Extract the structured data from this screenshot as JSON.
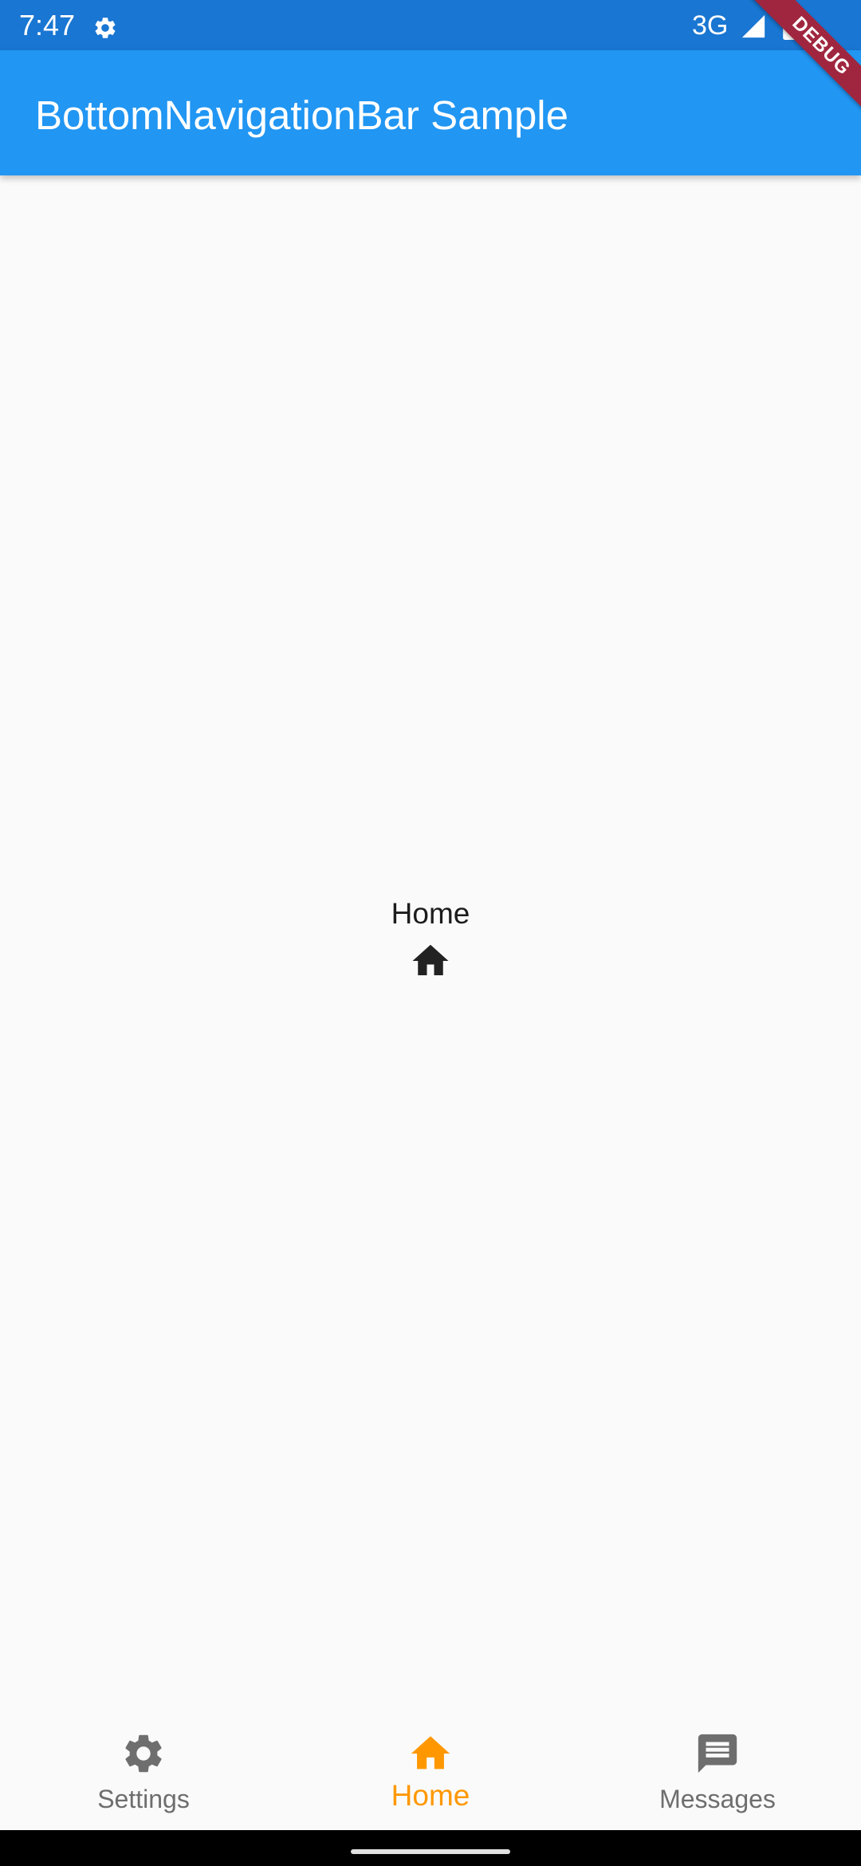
{
  "status_bar": {
    "time": "7:47",
    "network": "3G",
    "icons": [
      "settings-gear-icon",
      "signal-icon",
      "battery-icon"
    ]
  },
  "app_bar": {
    "title": "BottomNavigationBar Sample"
  },
  "debug_banner": {
    "label": "DEBUG"
  },
  "body": {
    "label": "Home",
    "icon": "home-icon"
  },
  "bottom_nav": {
    "selected_index": 1,
    "active_color": "#ff9800",
    "inactive_color": "#6e6e6e",
    "items": [
      {
        "label": "Settings",
        "icon": "settings-icon"
      },
      {
        "label": "Home",
        "icon": "home-icon"
      },
      {
        "label": "Messages",
        "icon": "message-icon"
      }
    ]
  },
  "colors": {
    "status_bar": "#1976d2",
    "app_bar": "#2196f3",
    "background": "#fafafa",
    "debug_banner": "#a0263f"
  }
}
